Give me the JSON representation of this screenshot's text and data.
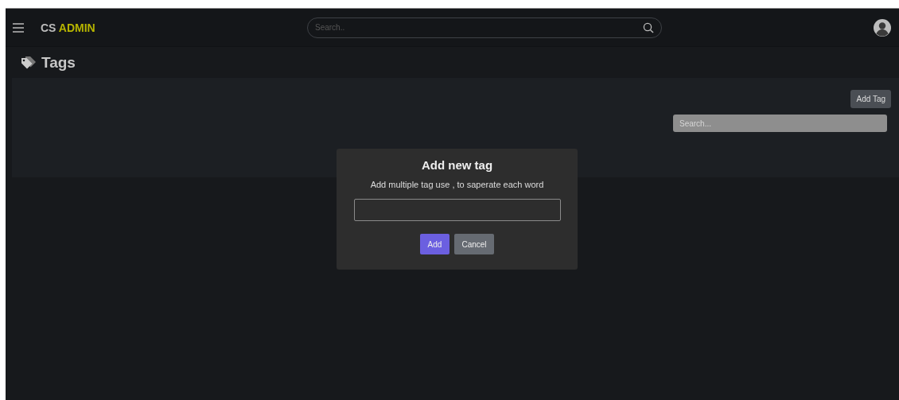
{
  "navbar": {
    "brand_prefix": "CS",
    "brand_highlight": "ADMIN",
    "search": {
      "placeholder": "Search.."
    }
  },
  "page": {
    "title": "Tags"
  },
  "toolbar": {
    "add_button": "Add Tag",
    "search": {
      "placeholder": "Search..."
    }
  },
  "modal": {
    "title": "Add new tag",
    "hint": "Add multiple tag use , to saperate each word",
    "buttons": [
      {
        "label": "Add",
        "kind": "primary"
      },
      {
        "label": "Cancel",
        "kind": "secondary"
      }
    ]
  }
}
